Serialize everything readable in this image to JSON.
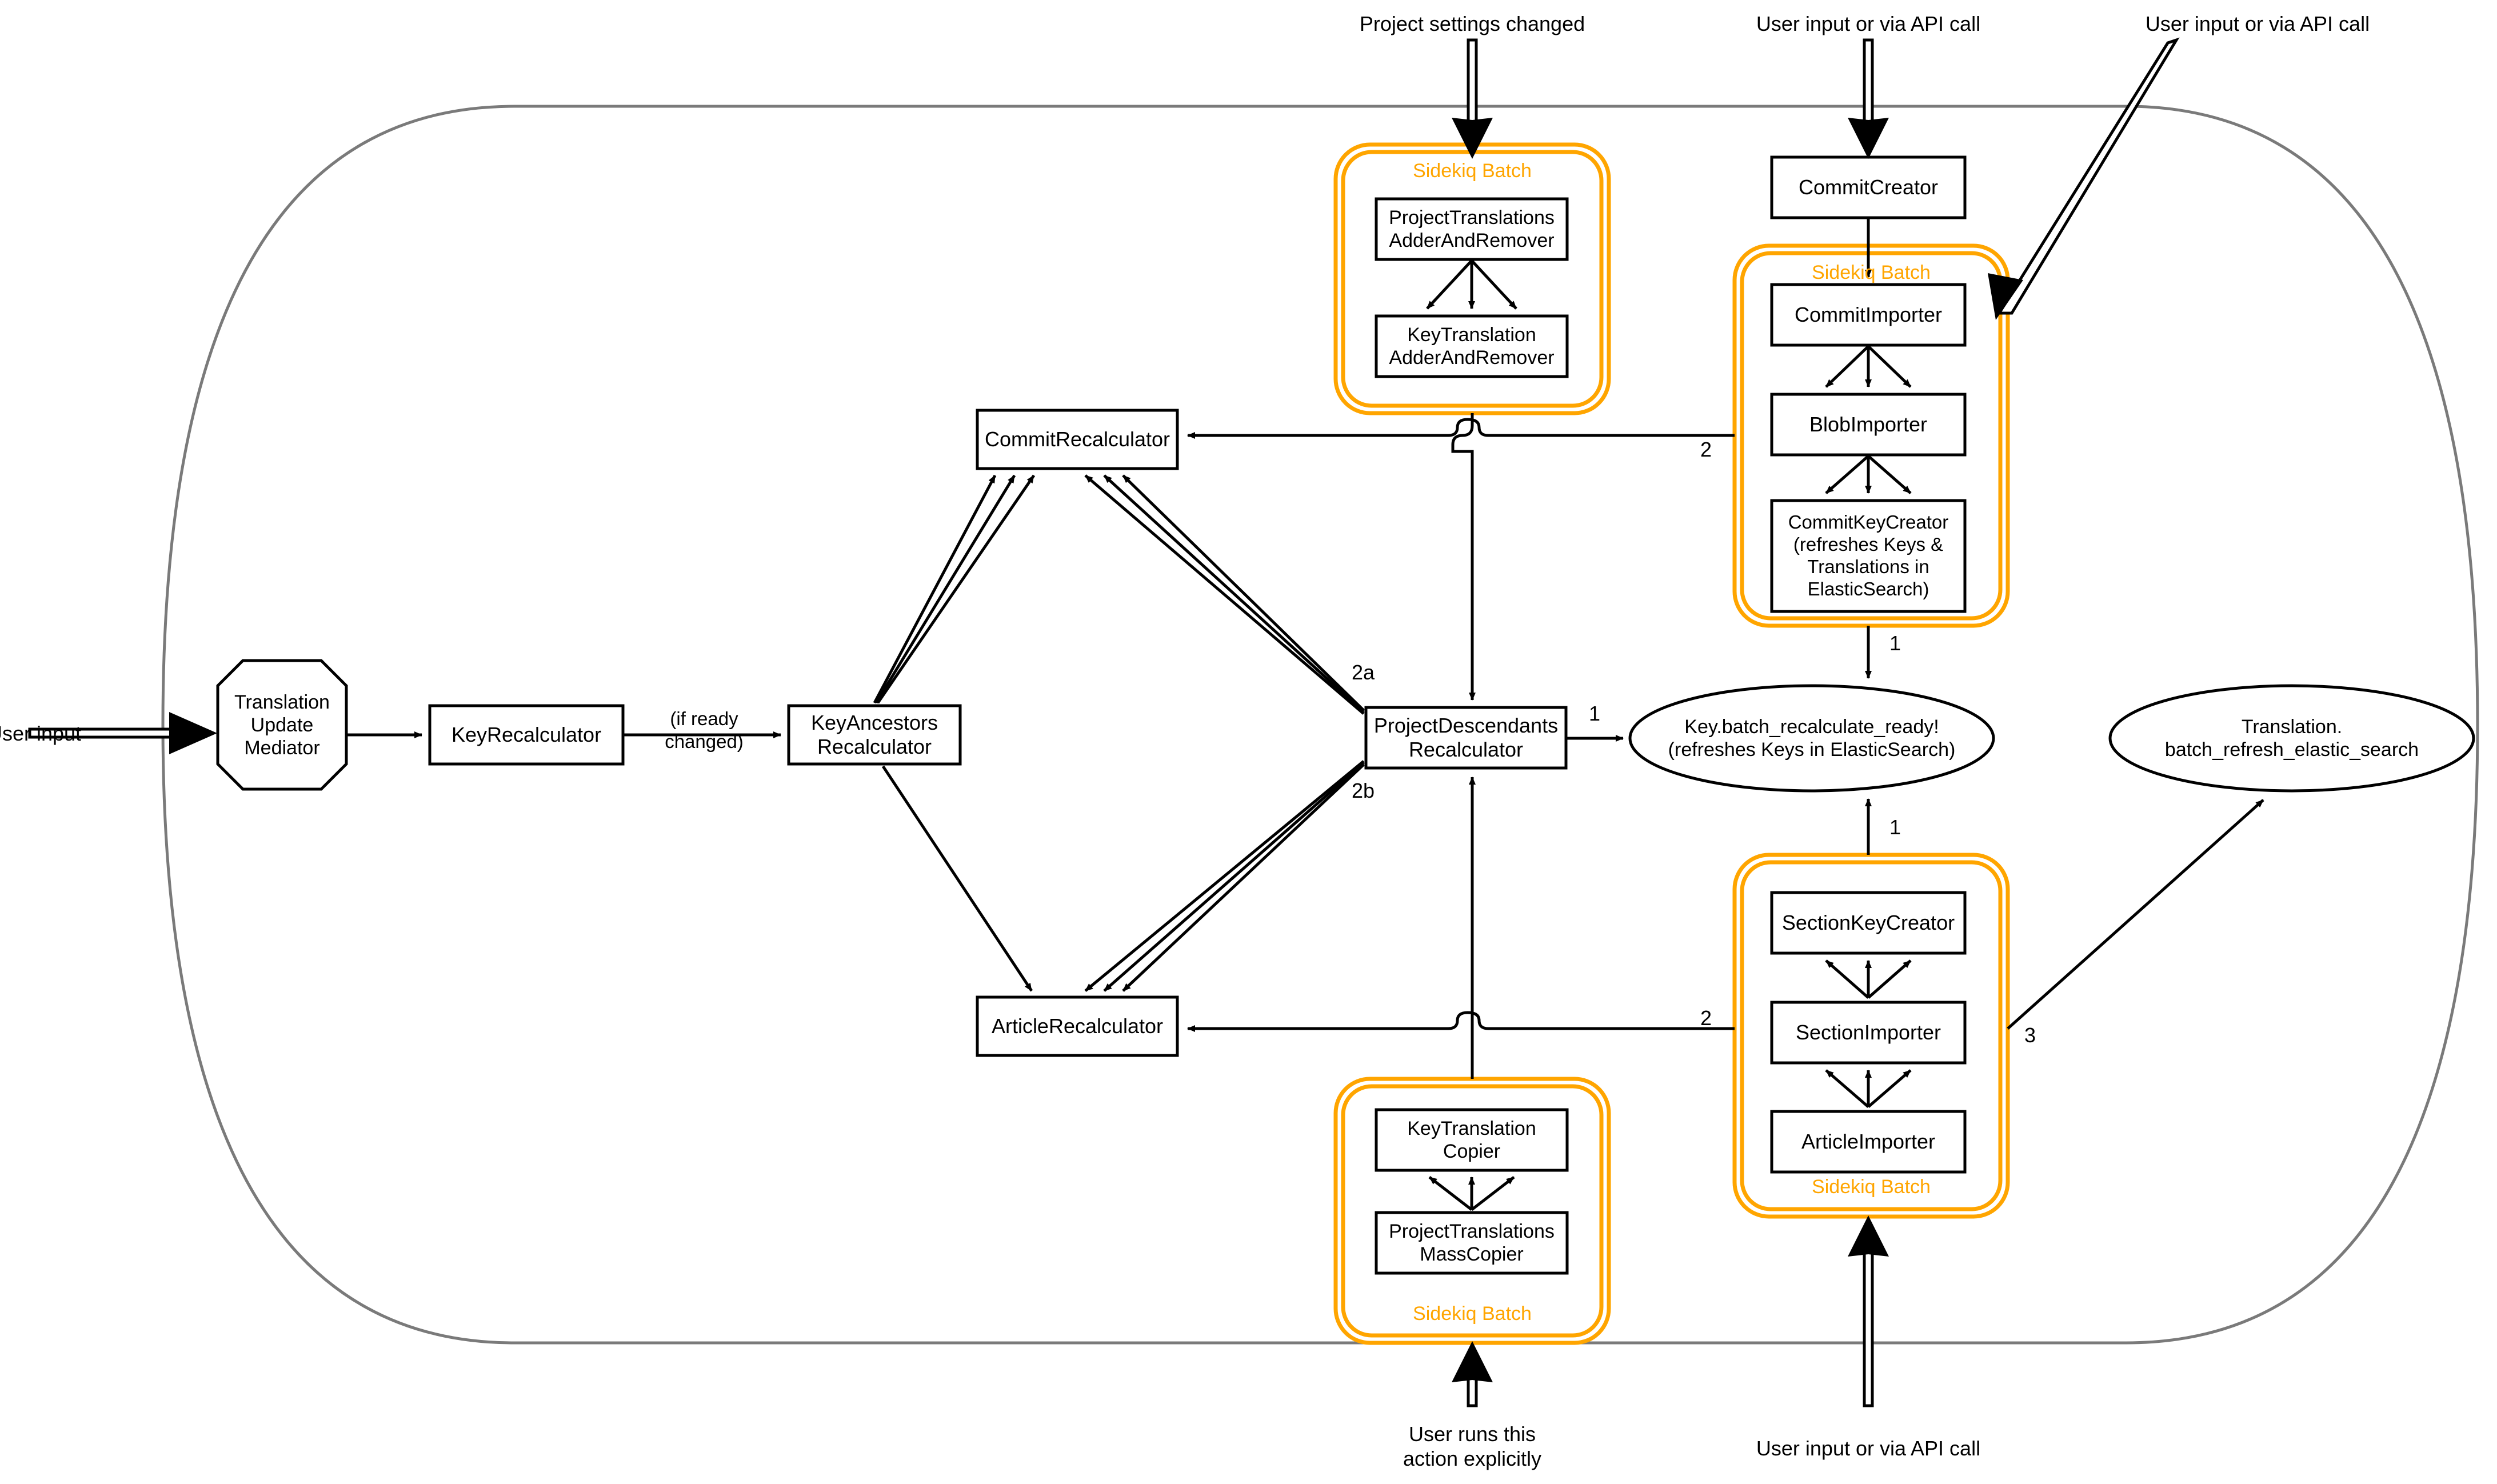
{
  "diagram": {
    "title_text": "",
    "colors": {
      "batch_orange": "#FFA500",
      "node_stroke": "#000000",
      "boundary_gray": "#7a7a7a",
      "background": "#FFFFFF"
    },
    "boundary": {
      "name": "system-boundary"
    },
    "external_inputs": [
      {
        "id": "in_project_settings",
        "label": "Project settings changed"
      },
      {
        "id": "in_commit_creator",
        "label": "User input or via API call"
      },
      {
        "id": "in_commit_importer",
        "label": "User input or via API call"
      },
      {
        "id": "in_user_input_left",
        "label": "User input"
      },
      {
        "id": "in_explicit_action",
        "label": "User runs this\naction explicitly"
      },
      {
        "id": "in_article_import",
        "label": "User input or via API call"
      }
    ],
    "nodes": [
      {
        "id": "translation_update_mediator",
        "label": "Translation\nUpdate\nMediator",
        "shape": "octagon"
      },
      {
        "id": "key_recalculator",
        "label": "KeyRecalculator",
        "shape": "box"
      },
      {
        "id": "key_ancestors_recalculator",
        "label": "KeyAncestors\nRecalculator",
        "shape": "box"
      },
      {
        "id": "commit_recalculator",
        "label": "CommitRecalculator",
        "shape": "box"
      },
      {
        "id": "article_recalculator",
        "label": "ArticleRecalculator",
        "shape": "box"
      },
      {
        "id": "project_descendants_recalculator",
        "label": "ProjectDescendants\nRecalculator",
        "shape": "box"
      },
      {
        "id": "project_translations_adder_and_remover",
        "label": "ProjectTranslations\nAdderAndRemover",
        "shape": "box"
      },
      {
        "id": "key_translation_adder_and_remover",
        "label": "KeyTranslation\nAdderAndRemover",
        "shape": "box"
      },
      {
        "id": "commit_creator",
        "label": "CommitCreator",
        "shape": "box"
      },
      {
        "id": "commit_importer",
        "label": "CommitImporter",
        "shape": "box"
      },
      {
        "id": "blob_importer",
        "label": "BlobImporter",
        "shape": "box"
      },
      {
        "id": "commit_key_creator",
        "label": "CommitKeyCreator\n(refreshes Keys &\nTranslations in\nElasticSearch)",
        "shape": "box"
      },
      {
        "id": "section_key_creator",
        "label": "SectionKeyCreator",
        "shape": "box"
      },
      {
        "id": "section_importer",
        "label": "SectionImporter",
        "shape": "box"
      },
      {
        "id": "article_importer",
        "label": "ArticleImporter",
        "shape": "box"
      },
      {
        "id": "key_translation_copier",
        "label": "KeyTranslation\nCopier",
        "shape": "box"
      },
      {
        "id": "project_translations_mass_copier",
        "label": "ProjectTranslations\nMassCopier",
        "shape": "box"
      },
      {
        "id": "key_batch_recalculate_ready",
        "label": "Key.batch_recalculate_ready!\n(refreshes Keys in ElasticSearch)",
        "shape": "ellipse"
      },
      {
        "id": "translation_batch_refresh_elastic_search",
        "label": "Translation.\nbatch_refresh_elastic_search",
        "shape": "ellipse"
      }
    ],
    "batches": [
      {
        "id": "batch_project_translations",
        "label": "Sidekiq Batch",
        "label_position": "top"
      },
      {
        "id": "batch_commit_import",
        "label": "Sidekiq Batch",
        "label_position": "top"
      },
      {
        "id": "batch_article_import",
        "label": "Sidekiq Batch",
        "label_position": "bottom"
      },
      {
        "id": "batch_translation_copy",
        "label": "Sidekiq Batch",
        "label_position": "bottom"
      }
    ],
    "edge_labels": [
      {
        "id": "lbl_if_ready_changed",
        "text": "(if ready\nchanged)"
      },
      {
        "id": "lbl_2a",
        "text": "2a"
      },
      {
        "id": "lbl_2b",
        "text": "2b"
      },
      {
        "id": "lbl_commit_import_2",
        "text": "2"
      },
      {
        "id": "lbl_section_import_2",
        "text": "2"
      },
      {
        "id": "lbl_pdr_1",
        "text": "1"
      },
      {
        "id": "lbl_ckc_1",
        "text": "1"
      },
      {
        "id": "lbl_skc_1",
        "text": "1"
      },
      {
        "id": "lbl_article_3",
        "text": "3"
      }
    ]
  }
}
